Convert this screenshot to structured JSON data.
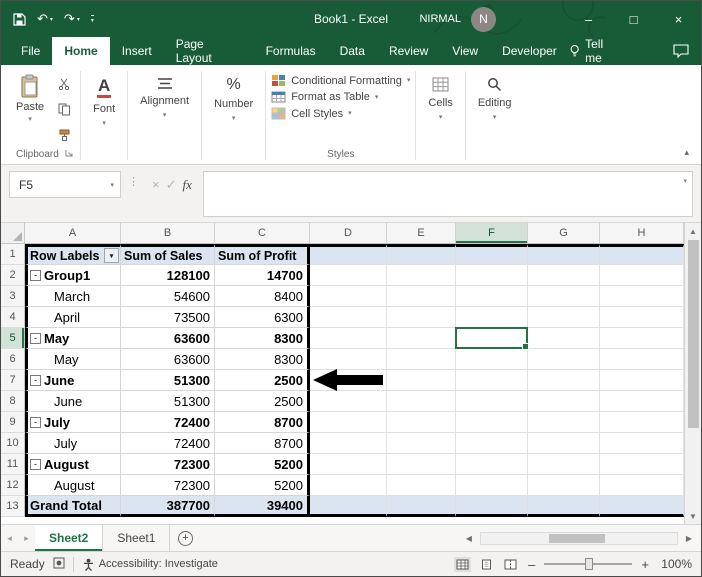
{
  "colors": {
    "titlebar_green": "#185c37",
    "accent_green": "#217346",
    "pivot_header_bg": "#dbe5f1",
    "pivot_border": "#000000"
  },
  "titlebar": {
    "title": "Book1 - Excel",
    "user_name": "NIRMAL",
    "avatar_initial": "N"
  },
  "menubar": {
    "tabs": [
      "File",
      "Home",
      "Insert",
      "Page Layout",
      "Formulas",
      "Data",
      "Review",
      "View",
      "Developer"
    ],
    "active_tab": "Home",
    "tell_me_label": "Tell me"
  },
  "ribbon": {
    "paste_label": "Paste",
    "clipboard_group_label": "Clipboard",
    "font_label": "Font",
    "alignment_label": "Alignment",
    "number_label": "Number",
    "conditional_formatting_label": "Conditional Formatting",
    "format_as_table_label": "Format as Table",
    "cell_styles_label": "Cell Styles",
    "styles_group_label": "Styles",
    "cells_label": "Cells",
    "editing_label": "Editing"
  },
  "formula_bar": {
    "name_box_value": "F5",
    "fx_label": "fx",
    "formula_value": ""
  },
  "grid": {
    "column_headers": [
      "A",
      "B",
      "C",
      "D",
      "E",
      "F",
      "G",
      "H"
    ],
    "selected_cell": "F5",
    "selected_column": "F",
    "selected_row": 5,
    "pivot_headers": [
      "Row Labels",
      "Sum of Sales",
      "Sum of Profit"
    ],
    "rows": [
      {
        "num": 1,
        "type": "header",
        "label": "Row Labels",
        "sales": "Sum of Sales",
        "profit": "Sum of Profit"
      },
      {
        "num": 2,
        "type": "group",
        "label": "Group1",
        "sales": "128100",
        "profit": "14700"
      },
      {
        "num": 3,
        "type": "item",
        "label": "March",
        "sales": "54600",
        "profit": "8400"
      },
      {
        "num": 4,
        "type": "item",
        "label": "April",
        "sales": "73500",
        "profit": "6300"
      },
      {
        "num": 5,
        "type": "group",
        "label": "May",
        "sales": "63600",
        "profit": "8300"
      },
      {
        "num": 6,
        "type": "item",
        "label": "May",
        "sales": "63600",
        "profit": "8300"
      },
      {
        "num": 7,
        "type": "group",
        "label": "June",
        "sales": "51300",
        "profit": "2500"
      },
      {
        "num": 8,
        "type": "item",
        "label": "June",
        "sales": "51300",
        "profit": "2500"
      },
      {
        "num": 9,
        "type": "group",
        "label": "July",
        "sales": "72400",
        "profit": "8700"
      },
      {
        "num": 10,
        "type": "item",
        "label": "July",
        "sales": "72400",
        "profit": "8700"
      },
      {
        "num": 11,
        "type": "group",
        "label": "August",
        "sales": "72300",
        "profit": "5200"
      },
      {
        "num": 12,
        "type": "item",
        "label": "August",
        "sales": "72300",
        "profit": "5200"
      },
      {
        "num": 13,
        "type": "total",
        "label": "Grand Total",
        "sales": "387700",
        "profit": "39400"
      }
    ],
    "annotation": {
      "type": "arrow-left",
      "points_at_row": 7
    }
  },
  "sheetbar": {
    "tabs": [
      "Sheet2",
      "Sheet1"
    ],
    "active_tab": "Sheet2"
  },
  "statusbar": {
    "mode": "Ready",
    "accessibility": "Accessibility: Investigate",
    "zoom": "100%"
  }
}
